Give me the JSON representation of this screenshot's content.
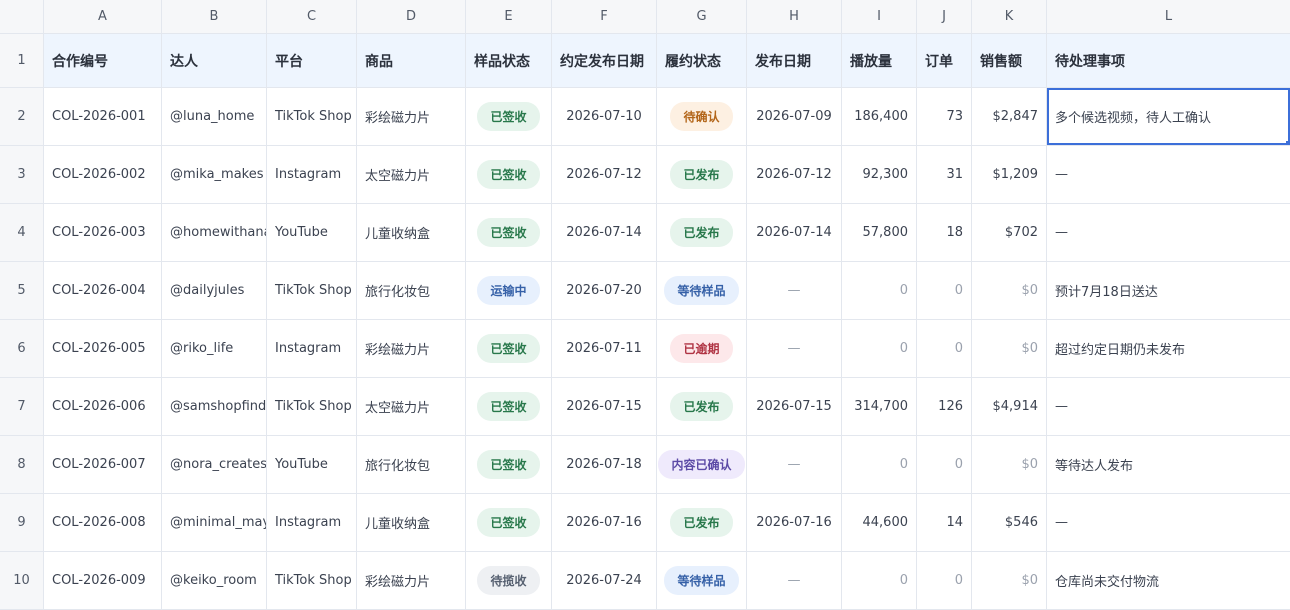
{
  "columns": [
    "A",
    "B",
    "C",
    "D",
    "E",
    "F",
    "G",
    "H",
    "I",
    "J",
    "K",
    "L"
  ],
  "header_row": {
    "num": "1",
    "labels": [
      "合作编号",
      "达人",
      "平台",
      "商品",
      "样品状态",
      "约定发布日期",
      "履约状态",
      "发布日期",
      "播放量",
      "订单",
      "销售额",
      "待处理事项"
    ]
  },
  "rows": [
    {
      "num": "2",
      "id": "COL-2026-001",
      "creator": "@luna_home",
      "platform": "TikTok Shop",
      "product": "彩绘磁力片",
      "sample": "已签收",
      "sample_tone": "green",
      "agreed": "2026-07-10",
      "fulfill": "待确认",
      "fulfill_tone": "orange",
      "published": "2026-07-09",
      "views": "186,400",
      "orders": "73",
      "sales": "$2,847",
      "todo": "多个候选视频，待人工确认"
    },
    {
      "num": "3",
      "id": "COL-2026-002",
      "creator": "@mika_makes",
      "platform": "Instagram",
      "product": "太空磁力片",
      "sample": "已签收",
      "sample_tone": "green",
      "agreed": "2026-07-12",
      "fulfill": "已发布",
      "fulfill_tone": "green",
      "published": "2026-07-12",
      "views": "92,300",
      "orders": "31",
      "sales": "$1,209",
      "todo": "—"
    },
    {
      "num": "4",
      "id": "COL-2026-003",
      "creator": "@homewithana",
      "platform": "YouTube",
      "product": "儿童收纳盒",
      "sample": "已签收",
      "sample_tone": "green",
      "agreed": "2026-07-14",
      "fulfill": "已发布",
      "fulfill_tone": "green",
      "published": "2026-07-14",
      "views": "57,800",
      "orders": "18",
      "sales": "$702",
      "todo": "—"
    },
    {
      "num": "5",
      "id": "COL-2026-004",
      "creator": "@dailyjules",
      "platform": "TikTok Shop",
      "product": "旅行化妆包",
      "sample": "运输中",
      "sample_tone": "blue",
      "agreed": "2026-07-20",
      "fulfill": "等待样品",
      "fulfill_tone": "blue",
      "published": "—",
      "views": "0",
      "orders": "0",
      "sales": "$0",
      "todo": "预计7月18日送达"
    },
    {
      "num": "6",
      "id": "COL-2026-005",
      "creator": "@riko_life",
      "platform": "Instagram",
      "product": "彩绘磁力片",
      "sample": "已签收",
      "sample_tone": "green",
      "agreed": "2026-07-11",
      "fulfill": "已逾期",
      "fulfill_tone": "red",
      "published": "—",
      "views": "0",
      "orders": "0",
      "sales": "$0",
      "todo": "超过约定日期仍未发布"
    },
    {
      "num": "7",
      "id": "COL-2026-006",
      "creator": "@samshopfinds",
      "platform": "TikTok Shop",
      "product": "太空磁力片",
      "sample": "已签收",
      "sample_tone": "green",
      "agreed": "2026-07-15",
      "fulfill": "已发布",
      "fulfill_tone": "green",
      "published": "2026-07-15",
      "views": "314,700",
      "orders": "126",
      "sales": "$4,914",
      "todo": "—"
    },
    {
      "num": "8",
      "id": "COL-2026-007",
      "creator": "@nora_creates",
      "platform": "YouTube",
      "product": "旅行化妆包",
      "sample": "已签收",
      "sample_tone": "green",
      "agreed": "2026-07-18",
      "fulfill": "内容已确认",
      "fulfill_tone": "purple",
      "published": "—",
      "views": "0",
      "orders": "0",
      "sales": "$0",
      "todo": "等待达人发布"
    },
    {
      "num": "9",
      "id": "COL-2026-008",
      "creator": "@minimal_may",
      "platform": "Instagram",
      "product": "儿童收纳盒",
      "sample": "已签收",
      "sample_tone": "green",
      "agreed": "2026-07-16",
      "fulfill": "已发布",
      "fulfill_tone": "green",
      "published": "2026-07-16",
      "views": "44,600",
      "orders": "14",
      "sales": "$546",
      "todo": "—"
    },
    {
      "num": "10",
      "id": "COL-2026-009",
      "creator": "@keiko_room",
      "platform": "TikTok Shop",
      "product": "彩绘磁力片",
      "sample": "待揽收",
      "sample_tone": "gray",
      "agreed": "2026-07-24",
      "fulfill": "等待样品",
      "fulfill_tone": "blue",
      "published": "—",
      "views": "0",
      "orders": "0",
      "sales": "$0",
      "todo": "仓库尚未交付物流"
    }
  ],
  "selected_cell": "L2",
  "colors": {
    "accent": "#3c6fd9",
    "header_bg": "#eef5fe",
    "grid_line": "#e3e7ee"
  }
}
